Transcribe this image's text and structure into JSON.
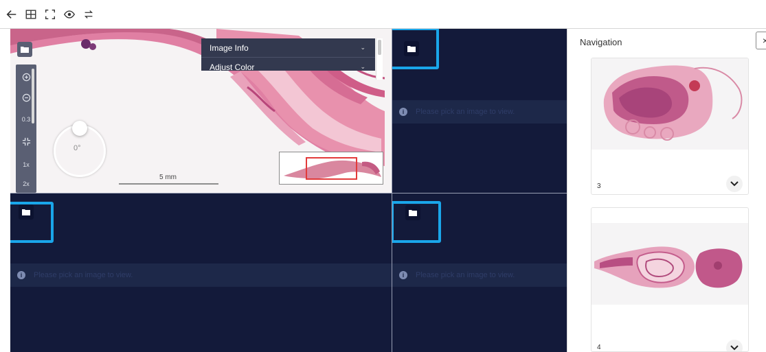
{
  "toolbar": {
    "buttons": [
      {
        "name": "back",
        "icon": "arrow-left-icon"
      },
      {
        "name": "grid-layout",
        "icon": "grid-icon"
      },
      {
        "name": "fullscreen",
        "icon": "fullscreen-icon"
      },
      {
        "name": "visibility",
        "icon": "eye-icon"
      },
      {
        "name": "sync",
        "icon": "swap-arrows-icon"
      }
    ]
  },
  "viewer": {
    "image_info_label": "Image Info",
    "adjust_color_label": "Adjust Color",
    "zoom_level": "0.3",
    "preset_1x": "1x",
    "preset_2x": "2x",
    "rotation_label": "0°",
    "scale_label": "5 mm",
    "empty_message": "Please pick an image to view."
  },
  "navigation": {
    "title": "Navigation",
    "close_label": "×",
    "slides": [
      {
        "label": "3"
      },
      {
        "label": "4"
      }
    ]
  },
  "colors": {
    "viewer_bg": "#131a3a",
    "highlight": "#1aa6ea",
    "minimap_box": "#e23a3a",
    "tissue": "#d9879f"
  }
}
